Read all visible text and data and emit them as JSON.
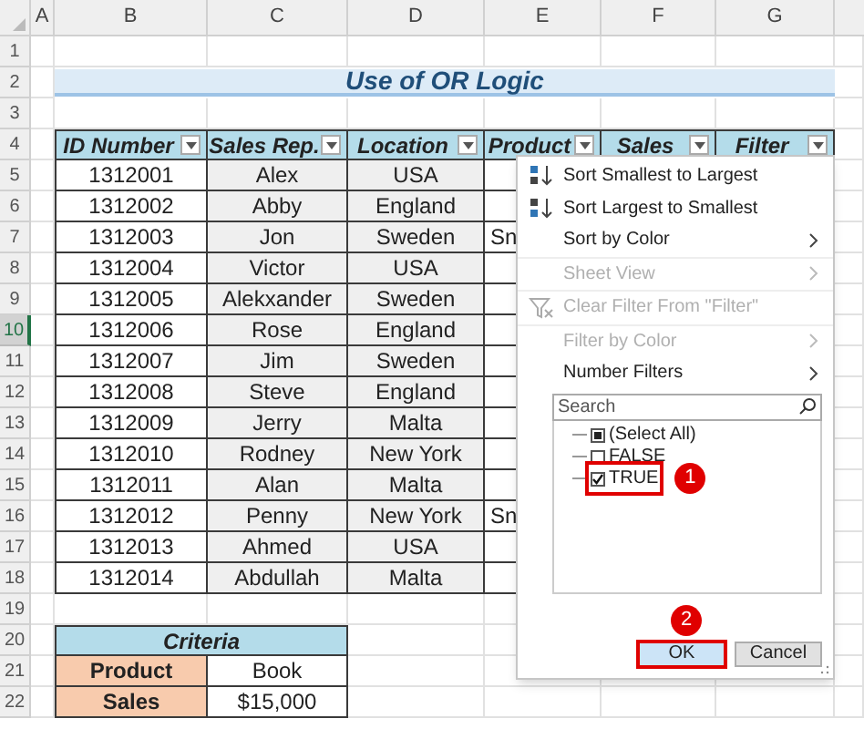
{
  "column_headers": [
    {
      "label": "A"
    },
    {
      "label": "B"
    },
    {
      "label": "C"
    },
    {
      "label": "D"
    },
    {
      "label": "E"
    },
    {
      "label": "F"
    },
    {
      "label": "G"
    }
  ],
  "row_headers": [
    {
      "label": "1",
      "selected": false
    },
    {
      "label": "2",
      "selected": false
    },
    {
      "label": "3",
      "selected": false
    },
    {
      "label": "4",
      "selected": false
    },
    {
      "label": "5",
      "selected": false
    },
    {
      "label": "6",
      "selected": false
    },
    {
      "label": "7",
      "selected": false
    },
    {
      "label": "8",
      "selected": false
    },
    {
      "label": "9",
      "selected": false
    },
    {
      "label": "10",
      "selected": true
    },
    {
      "label": "11",
      "selected": false
    },
    {
      "label": "12",
      "selected": false
    },
    {
      "label": "13",
      "selected": false
    },
    {
      "label": "14",
      "selected": false
    },
    {
      "label": "15",
      "selected": false
    },
    {
      "label": "16",
      "selected": false
    },
    {
      "label": "17",
      "selected": false
    },
    {
      "label": "18",
      "selected": false
    },
    {
      "label": "19",
      "selected": false
    },
    {
      "label": "20",
      "selected": false
    },
    {
      "label": "21",
      "selected": false
    },
    {
      "label": "22",
      "selected": false
    }
  ],
  "title": "Use of OR Logic",
  "table": {
    "columns": [
      "ID Number",
      "Sales Rep.",
      "Location",
      "Product",
      "Sales",
      "Filter"
    ],
    "rows": [
      {
        "id": "1312001",
        "rep": "Alex",
        "location": "USA"
      },
      {
        "id": "1312002",
        "rep": "Abby",
        "location": "England"
      },
      {
        "id": "1312003",
        "rep": "Jon",
        "location": "Sweden",
        "product": "Sn"
      },
      {
        "id": "1312004",
        "rep": "Victor",
        "location": "USA"
      },
      {
        "id": "1312005",
        "rep": "Alekxander",
        "location": "Sweden"
      },
      {
        "id": "1312006",
        "rep": "Rose",
        "location": "England"
      },
      {
        "id": "1312007",
        "rep": "Jim",
        "location": "Sweden"
      },
      {
        "id": "1312008",
        "rep": "Steve",
        "location": "England"
      },
      {
        "id": "1312009",
        "rep": "Jerry",
        "location": "Malta"
      },
      {
        "id": "1312010",
        "rep": "Rodney",
        "location": "New York"
      },
      {
        "id": "1312011",
        "rep": "Alan",
        "location": "Malta"
      },
      {
        "id": "1312012",
        "rep": "Penny",
        "location": "New York",
        "product": "Sn"
      },
      {
        "id": "1312013",
        "rep": "Ahmed",
        "location": "USA"
      },
      {
        "id": "1312014",
        "rep": "Abdullah",
        "location": "Malta"
      }
    ]
  },
  "criteria": {
    "title": "Criteria",
    "rows": [
      {
        "label": "Product",
        "value": "Book"
      },
      {
        "label": "Sales",
        "value": "$15,000"
      }
    ]
  },
  "filter_menu": {
    "items": [
      {
        "kind": "sort-asc",
        "label": "Sort Smallest to Largest",
        "disabled": false
      },
      {
        "kind": "sort-desc",
        "label": "Sort Largest to Smallest",
        "disabled": false
      },
      {
        "kind": "submenu",
        "label": "Sort by Color",
        "disabled": false
      },
      {
        "kind": "submenu",
        "label": "Sheet View",
        "disabled": true
      },
      {
        "kind": "clear",
        "label": "Clear Filter From \"Filter\"",
        "disabled": true
      },
      {
        "kind": "submenu",
        "label": "Filter by Color",
        "disabled": true
      },
      {
        "kind": "submenu",
        "label": "Number Filters",
        "disabled": false
      }
    ],
    "search": {
      "placeholder": "Search"
    },
    "values": [
      {
        "label": "(Select All)",
        "checked": false,
        "indeterminate": true
      },
      {
        "label": "FALSE",
        "checked": false
      },
      {
        "label": "TRUE",
        "checked": true,
        "callout": "1"
      }
    ],
    "buttons": [
      {
        "label": "OK",
        "highlighted": true,
        "callout": "2"
      },
      {
        "label": "Cancel",
        "highlighted": false
      }
    ]
  }
}
